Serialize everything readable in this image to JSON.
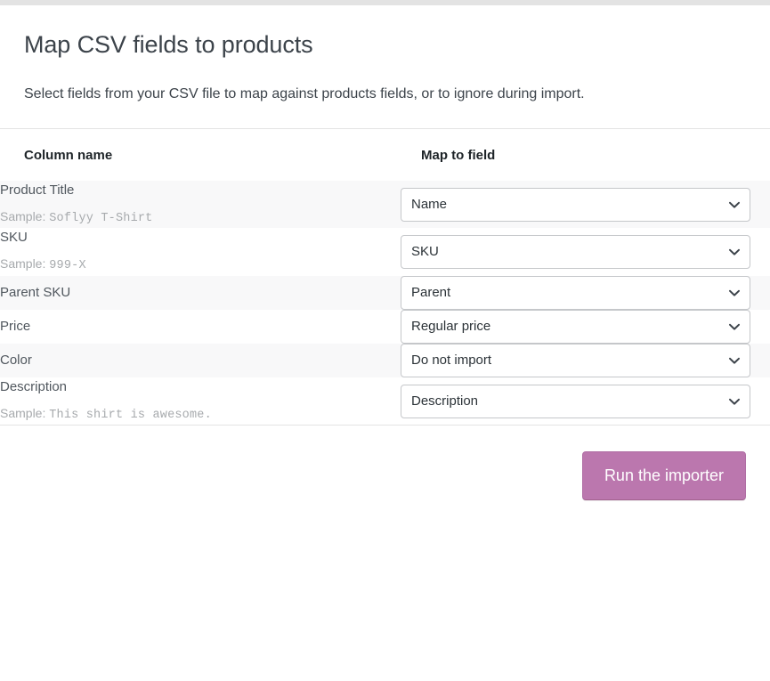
{
  "header": {
    "title": "Map CSV fields to products",
    "subtitle": "Select fields from your CSV file to map against products fields, or to ignore during import."
  },
  "table": {
    "columns": {
      "name_header": "Column name",
      "field_header": "Map to field"
    },
    "sample_prefix": "Sample:",
    "rows": [
      {
        "column_name": "Product Title",
        "sample_prefix": "Sample:",
        "sample_value": "Soflyy T-Shirt",
        "mapped_field": "Name"
      },
      {
        "column_name": "SKU",
        "sample_prefix": "Sample:",
        "sample_value": "999-X",
        "mapped_field": "SKU"
      },
      {
        "column_name": "Parent SKU",
        "sample_prefix": "",
        "sample_value": "",
        "mapped_field": "Parent"
      },
      {
        "column_name": "Price",
        "sample_prefix": "",
        "sample_value": "",
        "mapped_field": "Regular price"
      },
      {
        "column_name": "Color",
        "sample_prefix": "",
        "sample_value": "",
        "mapped_field": "Do not import"
      },
      {
        "column_name": "Description",
        "sample_prefix": "Sample:",
        "sample_value": "This shirt is awesome.",
        "mapped_field": "Description"
      }
    ]
  },
  "footer": {
    "run_button_label": "Run the importer"
  },
  "icons": {
    "select_chevron": "chevron-down-icon"
  },
  "colors": {
    "accent_button": "#bb77ae",
    "stripe_row": "#f8f8f9",
    "divider": "#e4e4e4",
    "label_text": "#50575e",
    "sample_text": "#a7aaad"
  }
}
